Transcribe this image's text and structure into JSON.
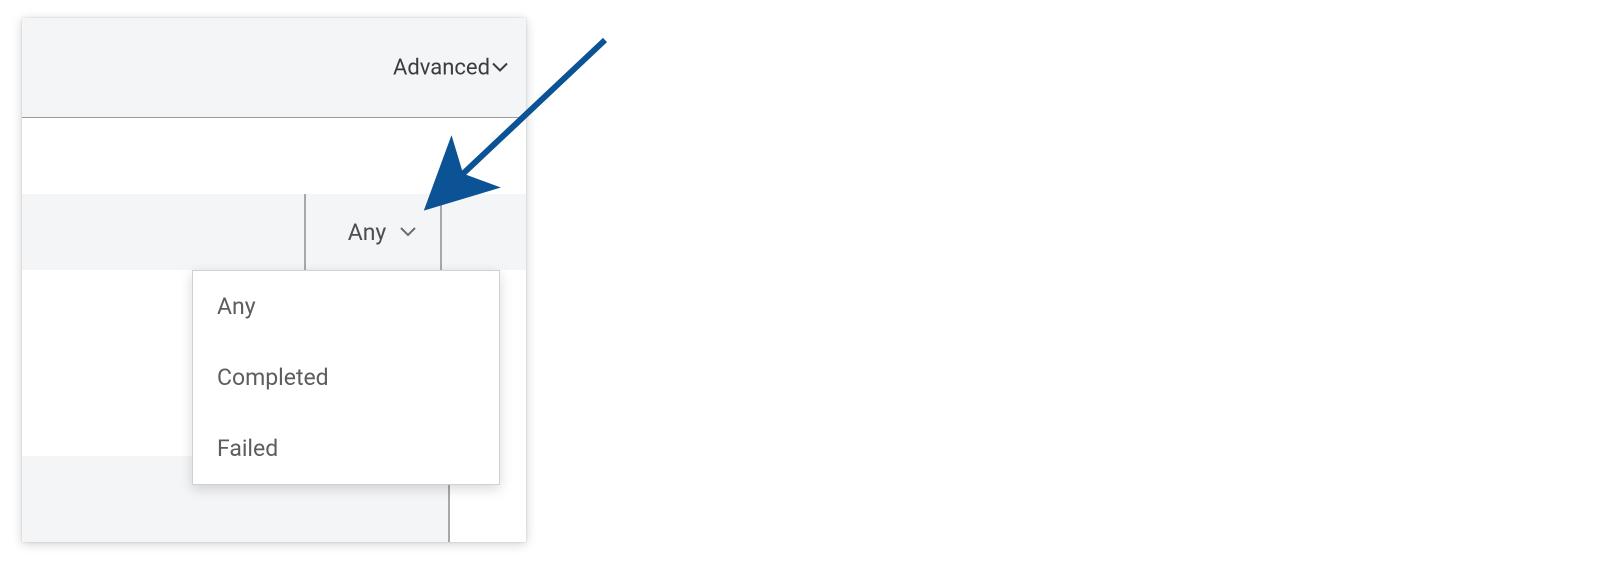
{
  "header": {
    "advanced_label": "Advanced"
  },
  "filter": {
    "selected": "Any",
    "options": [
      "Any",
      "Completed",
      "Failed"
    ]
  },
  "colors": {
    "arrow": "#0b5394"
  }
}
